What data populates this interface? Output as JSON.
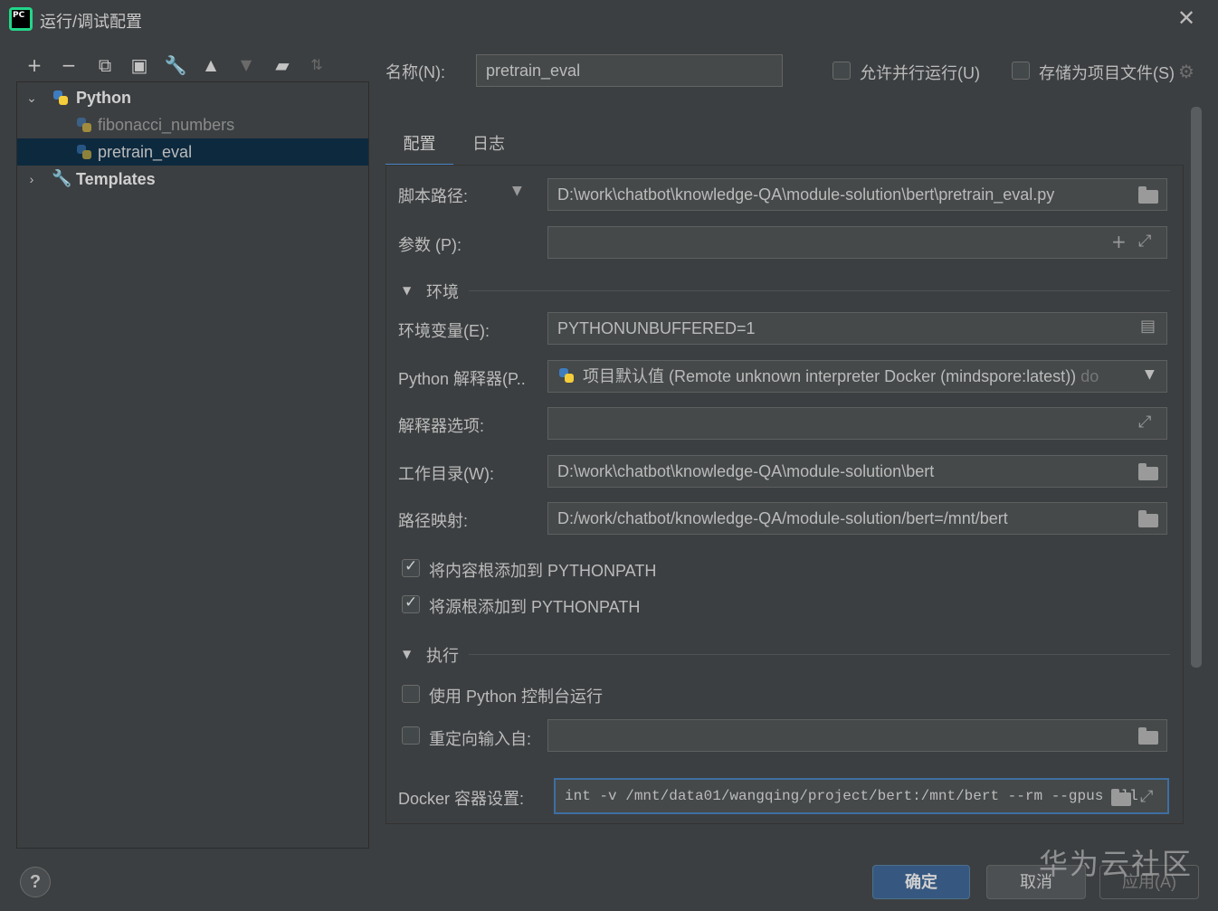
{
  "window": {
    "title": "运行/调试配置",
    "app_icon": "pycharm-logo",
    "app_icon_text": "PC"
  },
  "toolbar": {
    "icons": [
      "add-icon",
      "remove-icon",
      "copy-icon",
      "save-icon",
      "wrench-icon",
      "move-up-icon",
      "move-down-icon",
      "folder-add-icon",
      "sort-alpha-icon"
    ]
  },
  "tree": {
    "python_label": "Python",
    "items": [
      {
        "label": "fibonacci_numbers"
      },
      {
        "label": "pretrain_eval"
      }
    ],
    "templates_label": "Templates"
  },
  "header": {
    "name_label": "名称(N):",
    "name_value": "pretrain_eval",
    "allow_parallel_label": "允许并行运行(U)",
    "store_as_file_label": "存储为项目文件(S)"
  },
  "tabs": [
    {
      "label": "配置",
      "active": true
    },
    {
      "label": "日志",
      "active": false
    }
  ],
  "form": {
    "script_path_label": "脚本路径:",
    "script_path_value": "D:\\work\\chatbot\\knowledge-QA\\module-solution\\bert\\pretrain_eval.py",
    "params_label": "参数 (P):",
    "params_value": "",
    "env_section": "环境",
    "env_vars_label": "环境变量(E):",
    "env_vars_value": "PYTHONUNBUFFERED=1",
    "interpreter_label": "Python 解释器(P..",
    "interpreter_value": "项目默认值 (Remote  unknown interpreter Docker (mindspore:latest))",
    "interpreter_suffix": "do",
    "interp_options_label": "解释器选项:",
    "interp_options_value": "",
    "workdir_label": "工作目录(W):",
    "workdir_value": "D:\\work\\chatbot\\knowledge-QA\\module-solution\\bert",
    "path_map_label": "路径映射:",
    "path_map_value": "D:/work/chatbot/knowledge-QA/module-solution/bert=/mnt/bert",
    "add_content_roots_label": "将内容根添加到 PYTHONPATH",
    "add_source_roots_label": "将源根添加到 PYTHONPATH",
    "exec_section": "执行",
    "use_console_label": "使用 Python 控制台运行",
    "redirect_input_label": "重定向输入自:",
    "redirect_input_value": "",
    "docker_label": "Docker 容器设置:",
    "docker_value": "int -v /mnt/data01/wangqing/project/bert:/mnt/bert --rm --gpus all"
  },
  "footer": {
    "help_label": "?",
    "ok_label": "确定",
    "cancel_label": "取消",
    "apply_label": "应用(A)",
    "watermark": "华为云社区"
  },
  "colors": {
    "background": "#3c3f41",
    "selection": "#0d293e",
    "accent": "#4a88c7",
    "primary_button": "#365880"
  }
}
